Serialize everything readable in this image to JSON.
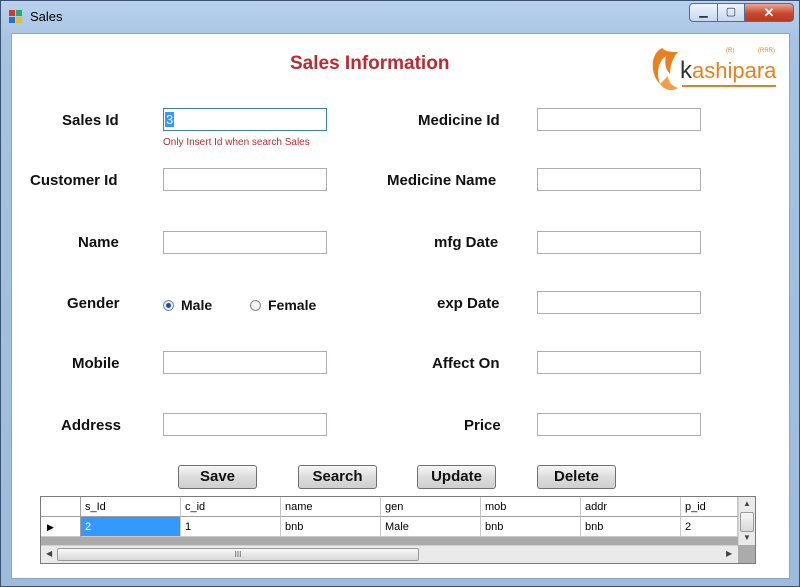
{
  "window": {
    "title": "Sales",
    "icon": "app-form-icon",
    "controls": {
      "minimize": "minimize-icon",
      "maximize": "maximize-icon",
      "close": "close-icon"
    }
  },
  "form": {
    "title": "Sales Information",
    "hint": "Only Insert Id when search Sales",
    "left_fields": [
      {
        "label": "Sales Id",
        "value": "3"
      },
      {
        "label": "Customer Id",
        "value": ""
      },
      {
        "label": "Name",
        "value": ""
      },
      {
        "label": "Gender"
      },
      {
        "label": "Mobile",
        "value": ""
      },
      {
        "label": "Address",
        "value": ""
      }
    ],
    "gender_options": [
      {
        "label": "Male",
        "selected": true
      },
      {
        "label": "Female",
        "selected": false
      }
    ],
    "right_fields": [
      {
        "label": "Medicine Id",
        "value": ""
      },
      {
        "label": "Medicine Name",
        "value": ""
      },
      {
        "label": "mfg Date",
        "value": ""
      },
      {
        "label": "exp Date",
        "value": ""
      },
      {
        "label": "Affect On",
        "value": ""
      },
      {
        "label": "Price",
        "value": ""
      }
    ],
    "buttons": {
      "save": "Save",
      "search": "Search",
      "update": "Update",
      "delete": "Delete"
    }
  },
  "logo": {
    "text": "kashipara",
    "small_left": "(R)",
    "small_right": "(RRR)",
    "accent": "#e8801e"
  },
  "grid": {
    "columns": [
      "s_Id",
      "c_id",
      "name",
      "gen",
      "mob",
      "addr",
      "p_id"
    ],
    "rows": [
      [
        "2",
        "1",
        "bnb",
        "Male",
        "bnb",
        "bnb",
        "2"
      ]
    ],
    "scroll_grip": "III"
  },
  "colors": {
    "title_red": "#c0282f",
    "selection": "#3399ff"
  }
}
